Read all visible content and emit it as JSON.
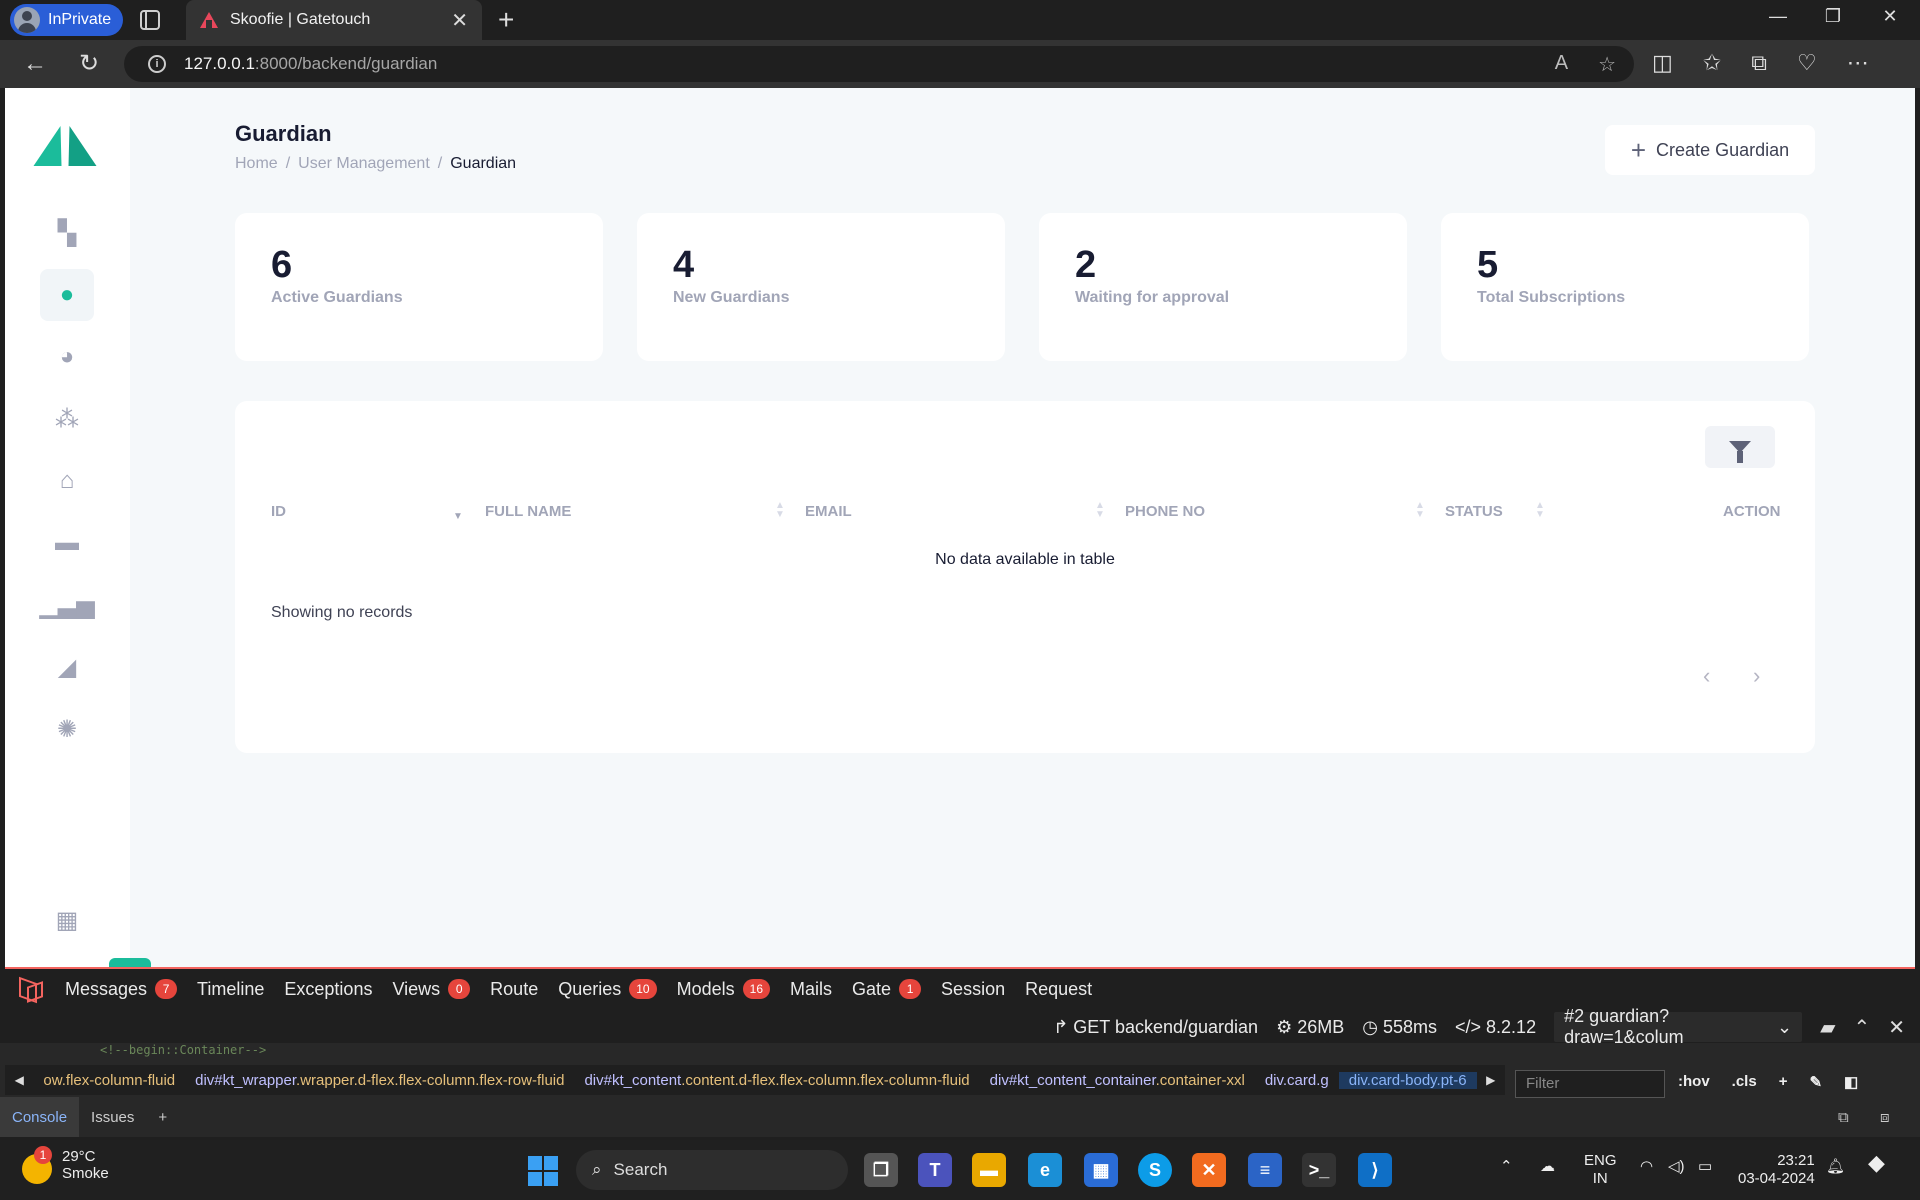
{
  "browser": {
    "inprivate_label": "InPrivate",
    "tab_title": "Skoofie | Gatetouch",
    "url_host": "127.0.0.1",
    "url_path": ":8000/backend/guardian"
  },
  "page": {
    "title": "Guardian",
    "breadcrumbs": [
      "Home",
      "User Management",
      "Guardian"
    ],
    "create_button": "Create Guardian",
    "stats": [
      {
        "value": "6",
        "label": "Active Guardians"
      },
      {
        "value": "4",
        "label": "New Guardians"
      },
      {
        "value": "2",
        "label": "Waiting for approval"
      },
      {
        "value": "5",
        "label": "Total Subscriptions"
      }
    ],
    "table": {
      "columns": [
        "ID",
        "FULL NAME",
        "EMAIL",
        "PHONE NO",
        "STATUS",
        "ACTION"
      ],
      "empty_text": "No data available in table",
      "records_text": "Showing no records"
    },
    "sidebar_icons": [
      "dashboard-icon",
      "user-icon",
      "user-settings-icon",
      "group-icon",
      "bank-icon",
      "card-icon",
      "bar-chart-icon",
      "area-chart-icon",
      "settings-icon",
      "apps-icon"
    ]
  },
  "debugbar": {
    "tabs": [
      {
        "label": "Messages",
        "count": "7"
      },
      {
        "label": "Timeline",
        "count": ""
      },
      {
        "label": "Exceptions",
        "count": ""
      },
      {
        "label": "Views",
        "count": "0"
      },
      {
        "label": "Route",
        "count": ""
      },
      {
        "label": "Queries",
        "count": "10"
      },
      {
        "label": "Models",
        "count": "16"
      },
      {
        "label": "Mails",
        "count": ""
      },
      {
        "label": "Gate",
        "count": "1"
      },
      {
        "label": "Session",
        "count": ""
      },
      {
        "label": "Request",
        "count": ""
      }
    ],
    "request": "GET backend/guardian",
    "memory": "26MB",
    "time": "558ms",
    "php": "8.2.12",
    "selected_request": "#2 guardian?draw=1&colum"
  },
  "devtools": {
    "code_snippet": "<!--begin::Container-->",
    "breadcrumbs": [
      {
        "tag": "",
        "cls": "ow.flex-column-fluid"
      },
      {
        "tag": "div#kt_wrapper",
        "cls": ".wrapper.d-flex.flex-column.flex-row-fluid"
      },
      {
        "tag": "div#kt_content",
        "cls": ".content.d-flex.flex-column.flex-column-fluid"
      },
      {
        "tag": "div#kt_content_container",
        "cls": ".container-xxl"
      },
      {
        "tag": "div.card.g",
        "cls": ""
      },
      {
        "tag": "div.card-body.pt-6",
        "cls": ""
      }
    ],
    "filter_placeholder": "Filter",
    "hov": ":hov",
    "cls": ".cls",
    "tabs": [
      "Console",
      "Issues"
    ]
  },
  "taskbar": {
    "notif_count": "1",
    "temperature": "29°C",
    "weather": "Smoke",
    "search": "Search",
    "lang1": "ENG",
    "lang2": "IN",
    "time": "23:21",
    "date": "03-04-2024"
  }
}
